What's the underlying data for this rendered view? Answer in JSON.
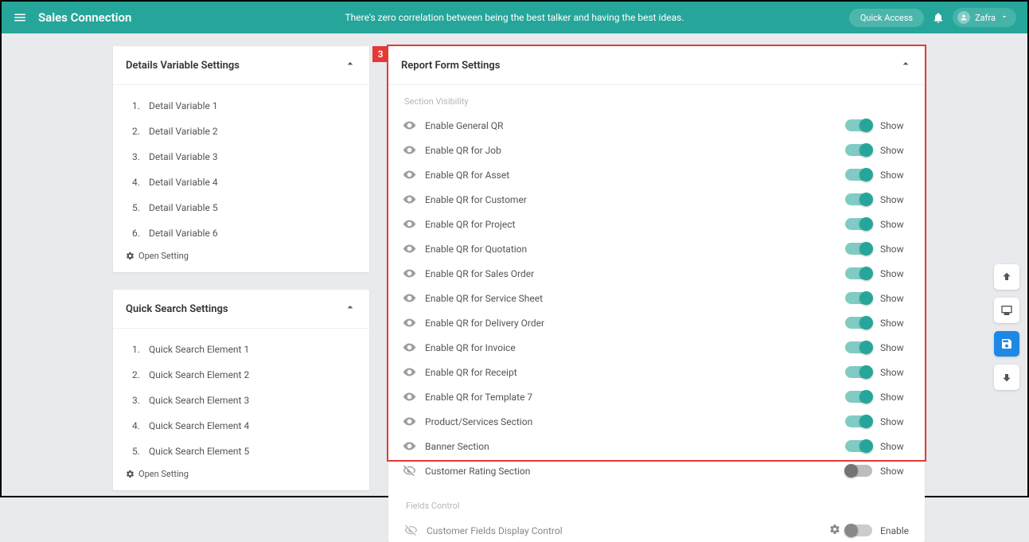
{
  "topbar": {
    "brand": "Sales Connection",
    "tagline": "There's zero correlation between being the best talker and having the best ideas.",
    "quick_access": "Quick Access",
    "user_name": "Zafra"
  },
  "details_card": {
    "title": "Details Variable Settings",
    "items": [
      "Detail Variable 1",
      "Detail Variable 2",
      "Detail Variable 3",
      "Detail Variable 4",
      "Detail Variable 5",
      "Detail Variable 6"
    ],
    "open_setting": "Open Setting"
  },
  "quicksearch_card": {
    "title": "Quick Search Settings",
    "items": [
      "Quick Search Element 1",
      "Quick Search Element 2",
      "Quick Search Element 3",
      "Quick Search Element 4",
      "Quick Search Element 5"
    ],
    "open_setting": "Open Setting"
  },
  "report_card": {
    "title": "Report Form Settings",
    "callout_number": "3",
    "section_label": "Section Visibility",
    "show_label": "Show",
    "enable_label": "Enable",
    "rows": [
      {
        "label": "Enable General QR",
        "on": true,
        "visible": true
      },
      {
        "label": "Enable QR for Job",
        "on": true,
        "visible": true
      },
      {
        "label": "Enable QR for Asset",
        "on": true,
        "visible": true
      },
      {
        "label": "Enable QR for Customer",
        "on": true,
        "visible": true
      },
      {
        "label": "Enable QR for Project",
        "on": true,
        "visible": true
      },
      {
        "label": "Enable QR for Quotation",
        "on": true,
        "visible": true
      },
      {
        "label": "Enable QR for Sales Order",
        "on": true,
        "visible": true
      },
      {
        "label": "Enable QR for Service Sheet",
        "on": true,
        "visible": true
      },
      {
        "label": "Enable QR for Delivery Order",
        "on": true,
        "visible": true
      },
      {
        "label": "Enable QR for Invoice",
        "on": true,
        "visible": true
      },
      {
        "label": "Enable QR for Receipt",
        "on": true,
        "visible": true
      },
      {
        "label": "Enable QR for Template 7",
        "on": true,
        "visible": true
      },
      {
        "label": "Product/Services Section",
        "on": true,
        "visible": true
      },
      {
        "label": "Banner Section",
        "on": true,
        "visible": true
      },
      {
        "label": "Customer Rating Section",
        "on": false,
        "visible": false
      }
    ],
    "fields_control": {
      "section_label": "Fields Control",
      "row_label": "Customer Fields Display Control"
    }
  }
}
